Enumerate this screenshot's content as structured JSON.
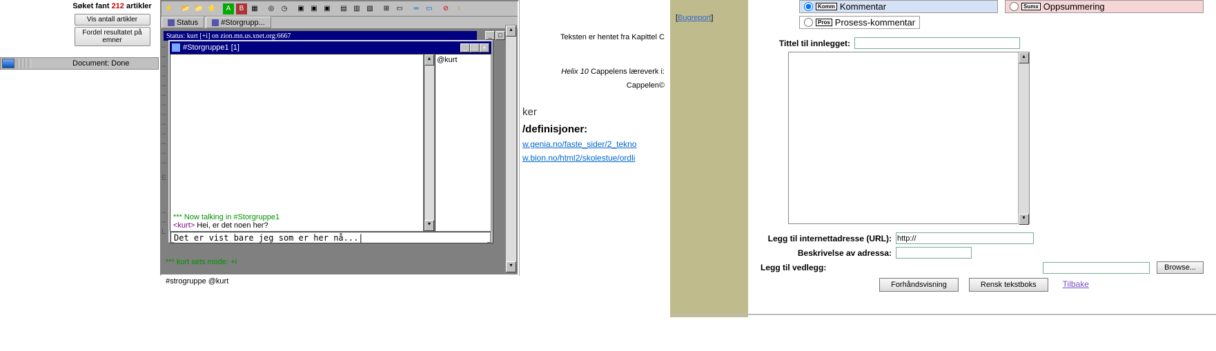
{
  "search": {
    "title_pre": "Søket fant ",
    "count": "212",
    "title_post": " artikler",
    "btn_count": "Vis antall artikler",
    "btn_split": "Fordel resultatet på emner"
  },
  "statusbar": {
    "text": "Document: Done"
  },
  "mirc": {
    "tabs": {
      "status": "Status",
      "channel": "#Storgrupp..."
    },
    "status_title": "Status: kurt [+i] on zion.mn.us.xnet.org:6667",
    "chan_title": "#Storgruppe1 [1]",
    "nicklist": [
      "@kurt"
    ],
    "msgs": {
      "now_talking": "*** Now talking in #Storgruppe1",
      "greet_nick": "<kurt>",
      "greet_text": " Hei, er det noen her?",
      "mode": "*** kurt sets mode: +i",
      "bottom": "#strogruppe @kurt"
    },
    "input_value": "Det er vist bare jeg som er her nå...|"
  },
  "content": {
    "src1": "Teksten er hentet fra Kapittel C",
    "src2_em": "Helix 10",
    "src2_rest": " Cappelens læreverk i:",
    "copy": "Cappelen©",
    "sub": "ker",
    "hdr": "/definisjoner:",
    "link1": "w.genia.no/faste_sider/2_tekno",
    "link2": "w.bion.no/html2/skolestue/ordli"
  },
  "olive": {
    "bug_l": "[",
    "bug": "Bugreport",
    "bug_r": "]"
  },
  "form": {
    "radios": {
      "komm_tag": "Komm",
      "komm": "Kommentar",
      "sumx_tag": "Sumx",
      "sumx": "Oppsummering",
      "pros_tag": "Pros",
      "pros": "Prosess-kommentar"
    },
    "title_label": "Tittel til innlegget:",
    "url_label": "Legg til internettadresse (URL):",
    "url_value": "http://",
    "desc_label": "Beskrivelse av adressa:",
    "attach_label": "Legg til vedlegg:",
    "browse": "Browse...",
    "preview": "Forhåndsvisning",
    "reset": "Rensk tekstboks",
    "back": "Tilbake"
  }
}
